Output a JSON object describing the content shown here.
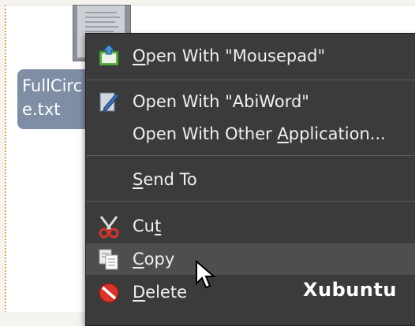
{
  "desktop": {
    "file_name": "FullCirc\ne.txt"
  },
  "menu": {
    "items": [
      {
        "label": "Open With \"Mousepad\"",
        "mnemonic": "O",
        "rest": "pen With \"Mousepad\"",
        "icon": "mousepad-icon"
      },
      {
        "label": "Open With \"AbiWord\"",
        "icon": "abiword-icon"
      },
      {
        "label": "Open With Other Application...",
        "before": "Open With Other ",
        "mnemonic": "A",
        "rest": "pplication..."
      },
      {
        "label": "Send To",
        "mnemonic": "S",
        "rest": "end To"
      },
      {
        "label": "Cut",
        "before": "Cu",
        "mnemonic": "t",
        "icon": "scissors-icon"
      },
      {
        "label": "Copy",
        "mnemonic": "C",
        "rest": "opy",
        "icon": "copy-icon"
      },
      {
        "label": "Delete",
        "mnemonic": "D",
        "rest": "elete",
        "icon": "delete-icon"
      }
    ]
  },
  "watermark": "Xubuntu",
  "colors": {
    "menu_bg": "#3b3b3b",
    "menu_highlight": "#4e4e4e",
    "selection": "#7f8ea5",
    "delete_red": "#d9342b"
  }
}
